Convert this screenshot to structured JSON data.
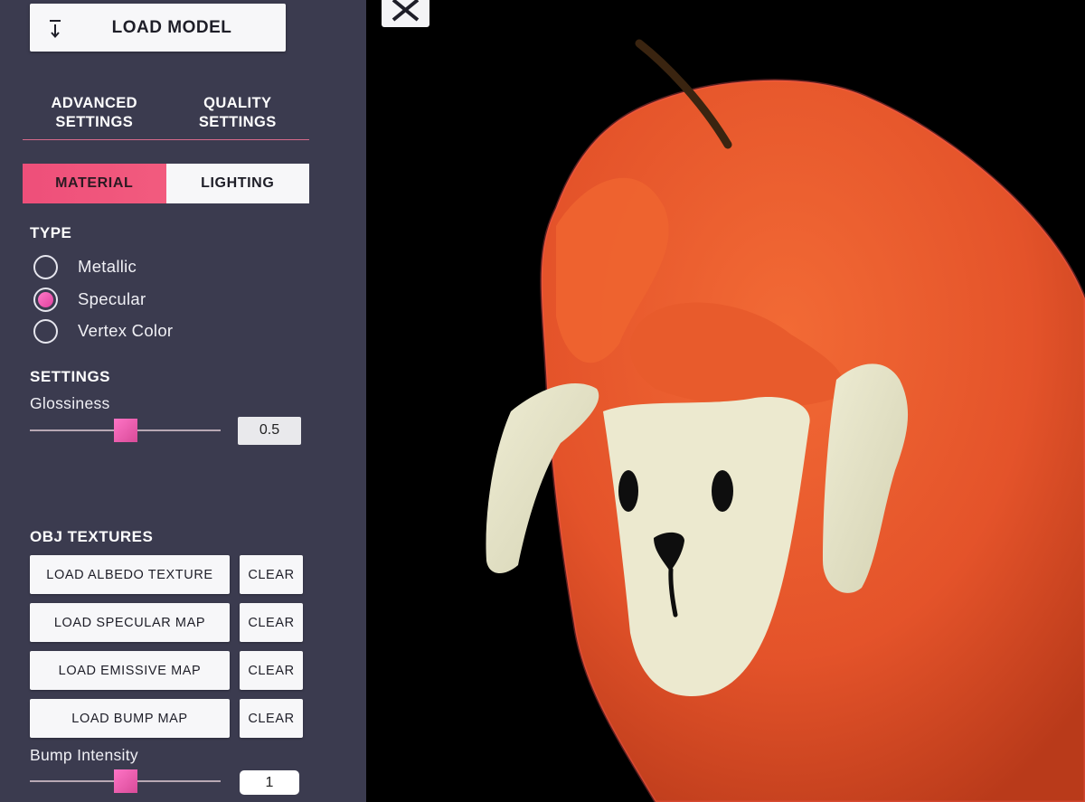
{
  "sidebar": {
    "load_model_label": "LOAD MODEL",
    "settings_tabs": [
      {
        "line1": "ADVANCED",
        "line2": "SETTINGS"
      },
      {
        "line1": "QUALITY",
        "line2": "SETTINGS"
      }
    ],
    "material_tabs": {
      "material": "MATERIAL",
      "lighting": "LIGHTING"
    },
    "type": {
      "title": "TYPE",
      "options": [
        "Metallic",
        "Specular",
        "Vertex Color"
      ],
      "selected": "Specular"
    },
    "settings": {
      "title": "SETTINGS",
      "glossiness_label": "Glossiness",
      "glossiness_value": "0.5"
    },
    "textures": {
      "title": "OBJ TEXTURES",
      "buttons": [
        "LOAD ALBEDO TEXTURE",
        "LOAD SPECULAR MAP",
        "LOAD EMISSIVE MAP",
        "LOAD BUMP MAP"
      ],
      "clear_label": "CLEAR"
    },
    "bump": {
      "label": "Bump Intensity",
      "value": "1"
    }
  },
  "colors": {
    "panel_bg": "#3b3b4f",
    "accent_pink": "#f25b7e",
    "viewport_bg": "#000000",
    "pepper_orange": "#e8582a",
    "face_cream": "#ece9cf"
  },
  "icons": {
    "load_model": "download-arrow-icon",
    "close": "close-x-icon"
  }
}
